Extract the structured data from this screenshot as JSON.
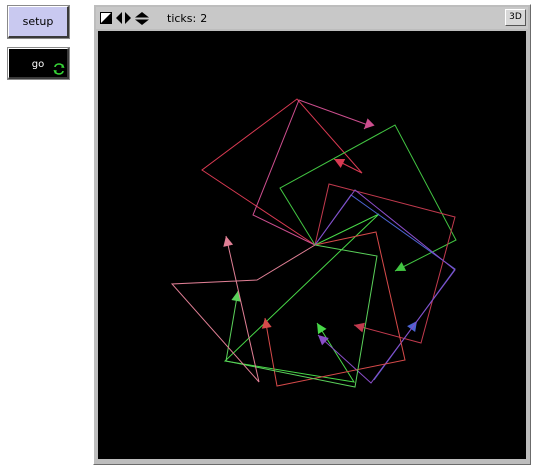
{
  "buttons": {
    "setup_label": "setup",
    "go_label": "go"
  },
  "toolbar": {
    "ticks_label": "ticks:",
    "ticks_value": "2",
    "three_d_label": "3D"
  },
  "colors": {
    "setup_bg": "#c9c9f0",
    "world_bg": "#000000",
    "forever_icon": "#37d637"
  },
  "turtles": [
    {
      "color": "#d83a52",
      "shape": "square-with-arrow"
    },
    {
      "color": "#cc4e8e",
      "shape": "square-with-arrow"
    },
    {
      "color": "#42c542",
      "shape": "square-with-arrow"
    },
    {
      "color": "#48d848",
      "shape": "square-with-arrow"
    },
    {
      "color": "#c23a4e",
      "shape": "square-with-arrow"
    },
    {
      "color": "#4b63d0",
      "shape": "square-with-arrow"
    },
    {
      "color": "#8a4dc8",
      "shape": "square-with-arrow"
    },
    {
      "color": "#d64a4a",
      "shape": "square-with-arrow"
    },
    {
      "color": "#5ad05a",
      "shape": "square-with-arrow"
    },
    {
      "color": "#e07f95",
      "shape": "square-with-arrow"
    }
  ]
}
